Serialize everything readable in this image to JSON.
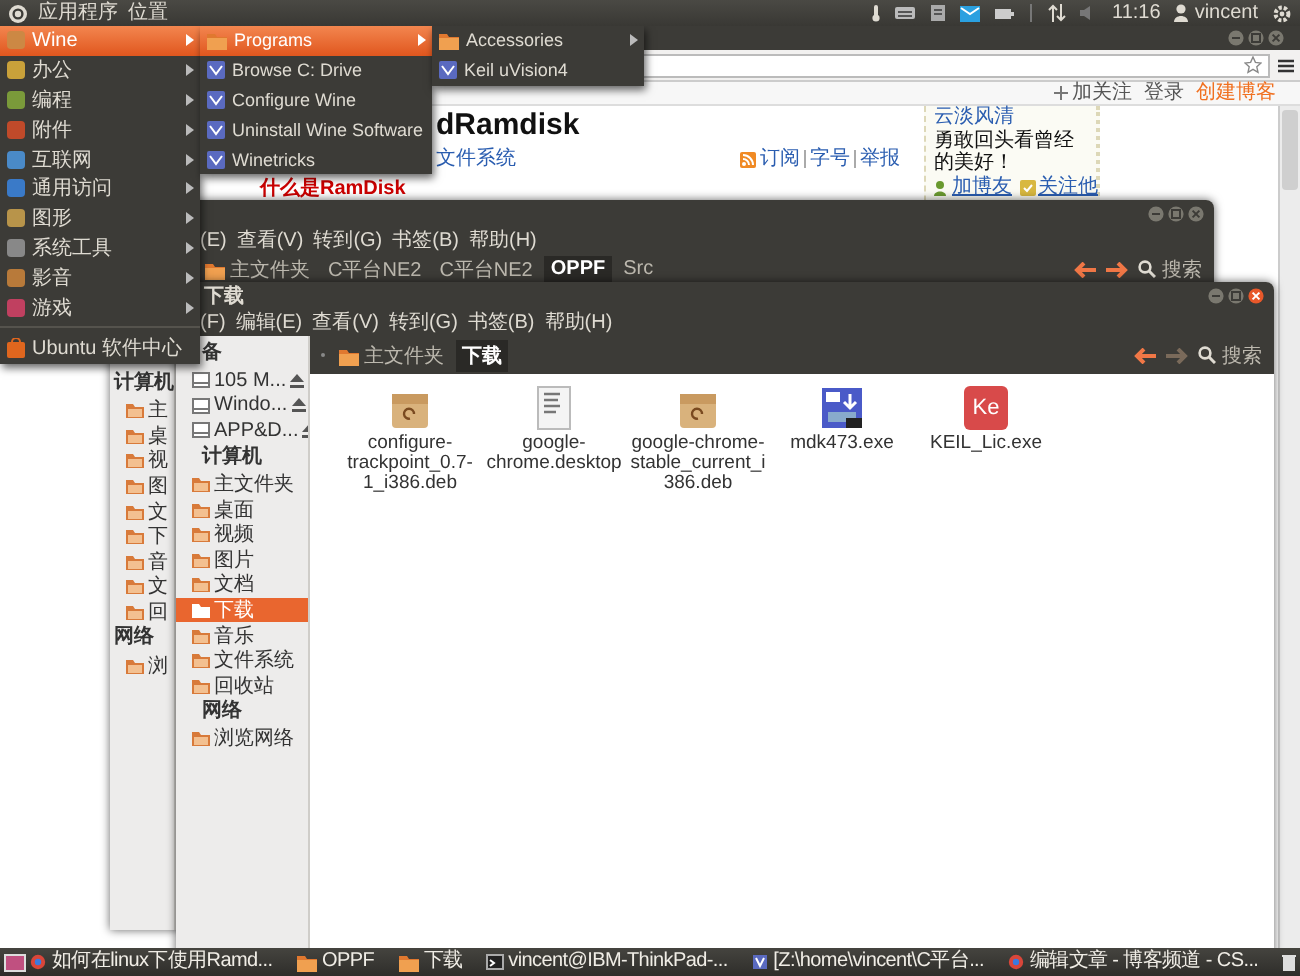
{
  "top_panel": {
    "menus": [
      "应用程序",
      "位置"
    ],
    "clock": "11:16",
    "user": "vincent"
  },
  "browser": {
    "blog_bar": {
      "follow": "加关注",
      "login": "登录",
      "create_blog": "创建博客"
    },
    "article": {
      "title": "dRamdisk",
      "category": "文件系统",
      "actions": [
        "订阅",
        "字号",
        "举报"
      ],
      "subtitle": "什么是RamDisk"
    },
    "profile": {
      "name": "云淡风清",
      "motto": "勇敢回头看曾经的美好！",
      "links": [
        "加博友",
        "关注他"
      ]
    }
  },
  "window_oppf": {
    "menu": [
      "(E)",
      "查看(V)",
      "转到(G)",
      "书签(B)",
      "帮助(H)"
    ],
    "path": [
      {
        "label": "主文件夹",
        "selected": false
      },
      {
        "label": "C平台NE2",
        "selected": false
      },
      {
        "label": "C平台NE2",
        "selected": false
      },
      {
        "label": "OPPF",
        "selected": true
      },
      {
        "label": "Src",
        "selected": false
      }
    ],
    "nav": {
      "back_enabled": true,
      "forward_enabled": true
    },
    "search": "搜索",
    "sidebar": [
      {
        "kind": "header",
        "label": "计算机"
      },
      {
        "kind": "place",
        "label": "主",
        "selected": false
      },
      {
        "kind": "place",
        "label": "桌",
        "selected": false
      },
      {
        "kind": "place",
        "label": "视",
        "selected": false
      },
      {
        "kind": "place",
        "label": "图",
        "selected": false
      },
      {
        "kind": "place",
        "label": "文",
        "selected": false
      },
      {
        "kind": "place",
        "label": "下",
        "selected": false
      },
      {
        "kind": "place",
        "label": "音",
        "selected": false
      },
      {
        "kind": "place",
        "label": "文",
        "selected": false
      },
      {
        "kind": "place",
        "label": "回",
        "selected": false
      },
      {
        "kind": "header",
        "label": "网络"
      },
      {
        "kind": "place",
        "label": "浏",
        "selected": false
      }
    ]
  },
  "window_downloads": {
    "title": "下载",
    "menu": [
      "(F)",
      "编辑(E)",
      "查看(V)",
      "转到(G)",
      "书签(B)",
      "帮助(H)"
    ],
    "path": [
      {
        "label": "主文件夹",
        "selected": false
      },
      {
        "label": "下载",
        "selected": true
      }
    ],
    "nav": {
      "back_enabled": true,
      "forward_enabled": false
    },
    "search": "搜索",
    "sidebar": [
      {
        "kind": "header",
        "label": "备"
      },
      {
        "kind": "drive",
        "label": "105 M...",
        "selected": false
      },
      {
        "kind": "drive",
        "label": "Windo...",
        "selected": false
      },
      {
        "kind": "drive",
        "label": "APP&D...",
        "selected": false
      },
      {
        "kind": "header",
        "label": "计算机"
      },
      {
        "kind": "place",
        "label": "主文件夹",
        "selected": false
      },
      {
        "kind": "place",
        "label": "桌面",
        "selected": false
      },
      {
        "kind": "place",
        "label": "视频",
        "selected": false
      },
      {
        "kind": "place",
        "label": "图片",
        "selected": false
      },
      {
        "kind": "place",
        "label": "文档",
        "selected": false
      },
      {
        "kind": "place",
        "label": "下载",
        "selected": true
      },
      {
        "kind": "place",
        "label": "音乐",
        "selected": false
      },
      {
        "kind": "place",
        "label": "文件系统",
        "selected": false
      },
      {
        "kind": "place",
        "label": "回收站",
        "selected": false
      },
      {
        "kind": "header",
        "label": "网络"
      },
      {
        "kind": "place",
        "label": "浏览网络",
        "selected": false
      }
    ],
    "files": [
      {
        "name": "configure-trackpoint_0.7-1_i386.deb",
        "kind": "package"
      },
      {
        "name": "google-chrome.desktop",
        "kind": "document"
      },
      {
        "name": "google-chrome-stable_current_i386.deb",
        "kind": "package"
      },
      {
        "name": "mdk473.exe",
        "kind": "installer"
      },
      {
        "name": "KEIL_Lic.exe",
        "kind": "application",
        "badge": "Ke"
      }
    ]
  },
  "app_menu": {
    "items": [
      {
        "label": "Wine",
        "selected": true,
        "submenu": true
      },
      {
        "label": "办公",
        "selected": false,
        "submenu": true
      },
      {
        "label": "编程",
        "selected": false,
        "submenu": true
      },
      {
        "label": "附件",
        "selected": false,
        "submenu": true
      },
      {
        "label": "互联网",
        "selected": false,
        "submenu": true
      },
      {
        "label": "通用访问",
        "selected": false,
        "submenu": true
      },
      {
        "label": "图形",
        "selected": false,
        "submenu": true
      },
      {
        "label": "系统工具",
        "selected": false,
        "submenu": true
      },
      {
        "label": "影音",
        "selected": false,
        "submenu": true
      },
      {
        "label": "游戏",
        "selected": false,
        "submenu": true
      }
    ],
    "footer": "Ubuntu 软件中心"
  },
  "wine_menu": {
    "items": [
      {
        "label": "Programs",
        "selected": true,
        "submenu": true
      },
      {
        "label": "Browse C: Drive",
        "selected": false,
        "submenu": false
      },
      {
        "label": "Configure Wine",
        "selected": false,
        "submenu": false
      },
      {
        "label": "Uninstall Wine Software",
        "selected": false,
        "submenu": false
      },
      {
        "label": "Winetricks",
        "selected": false,
        "submenu": false
      }
    ]
  },
  "programs_menu": {
    "items": [
      {
        "label": "Accessories",
        "selected": false,
        "submenu": true
      },
      {
        "label": "Keil uVision4",
        "selected": false,
        "submenu": false
      }
    ]
  },
  "taskbar": {
    "items": [
      {
        "label": "如何在linux下使用Ramd...",
        "kind": "browser"
      },
      {
        "label": "OPPF",
        "kind": "folder"
      },
      {
        "label": "下载",
        "kind": "folder"
      },
      {
        "label": "vincent@IBM-ThinkPad-...",
        "kind": "terminal"
      },
      {
        "label": "[Z:\\home\\vincent\\C平台...",
        "kind": "program"
      },
      {
        "label": "编辑文章 - 博客频道 - CS...",
        "kind": "browser"
      }
    ]
  }
}
